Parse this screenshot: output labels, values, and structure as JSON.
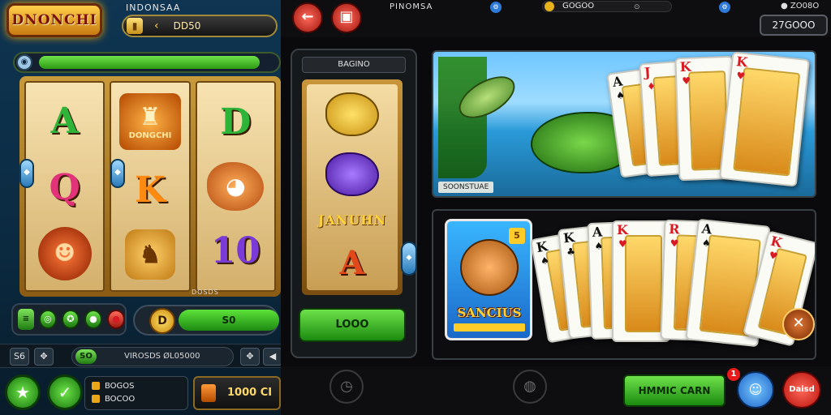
{
  "left": {
    "logo_text": "DNONCHI",
    "top_title": "INDONSAA",
    "balance_value": "DD50",
    "progress_fraction": 0.93,
    "reels": [
      [
        "A",
        "DONGCHI",
        "⌾"
      ],
      [
        "Q",
        "K",
        "🐈"
      ],
      [
        "D",
        "🐟",
        "10"
      ]
    ],
    "win_label": "DOSDS",
    "spin_value": "S0",
    "spin_coin": "D",
    "row2": {
      "left_a": "S6",
      "left_b": "✥",
      "tag": "SO",
      "text": "VIROSDS  ØL05000",
      "right_a": "✥",
      "right_b": "◀"
    },
    "balances": [
      "BOGOS",
      "BOCOO"
    ],
    "total": "1000 CI"
  },
  "right": {
    "back_icon": "←",
    "title": "PINOMSA",
    "coin_value": "GOGOO",
    "balance": "27GOOO",
    "top_right_text": "ZO08O",
    "mini": {
      "header": "BAGINO",
      "label": "JANUHN",
      "button": "LOOO"
    },
    "scene_caption": "SOONSTUAE",
    "cards_top": [
      {
        "rank": "A",
        "suit": "♠",
        "color": "blk"
      },
      {
        "rank": "J",
        "suit": "♦",
        "color": "red"
      },
      {
        "rank": "K",
        "suit": "♥",
        "color": "red"
      },
      {
        "rank": "K",
        "suit": "♥",
        "color": "red"
      }
    ],
    "big_card": {
      "label": "SANCIUS",
      "badge": "5"
    },
    "cards_bottom": [
      {
        "rank": "K",
        "suit": "♠",
        "color": "blk"
      },
      {
        "rank": "K",
        "suit": "♣",
        "color": "blk"
      },
      {
        "rank": "A",
        "suit": "♠",
        "color": "blk"
      },
      {
        "rank": "K",
        "suit": "♥",
        "color": "red"
      },
      {
        "rank": "R",
        "suit": "♥",
        "color": "red"
      },
      {
        "rank": "A",
        "suit": "♠",
        "color": "blk"
      },
      {
        "rank": "K",
        "suit": "♥",
        "color": "red"
      }
    ],
    "game_button": "HMMIC CARN",
    "notif_count": "1",
    "red_button": "Daisd"
  }
}
